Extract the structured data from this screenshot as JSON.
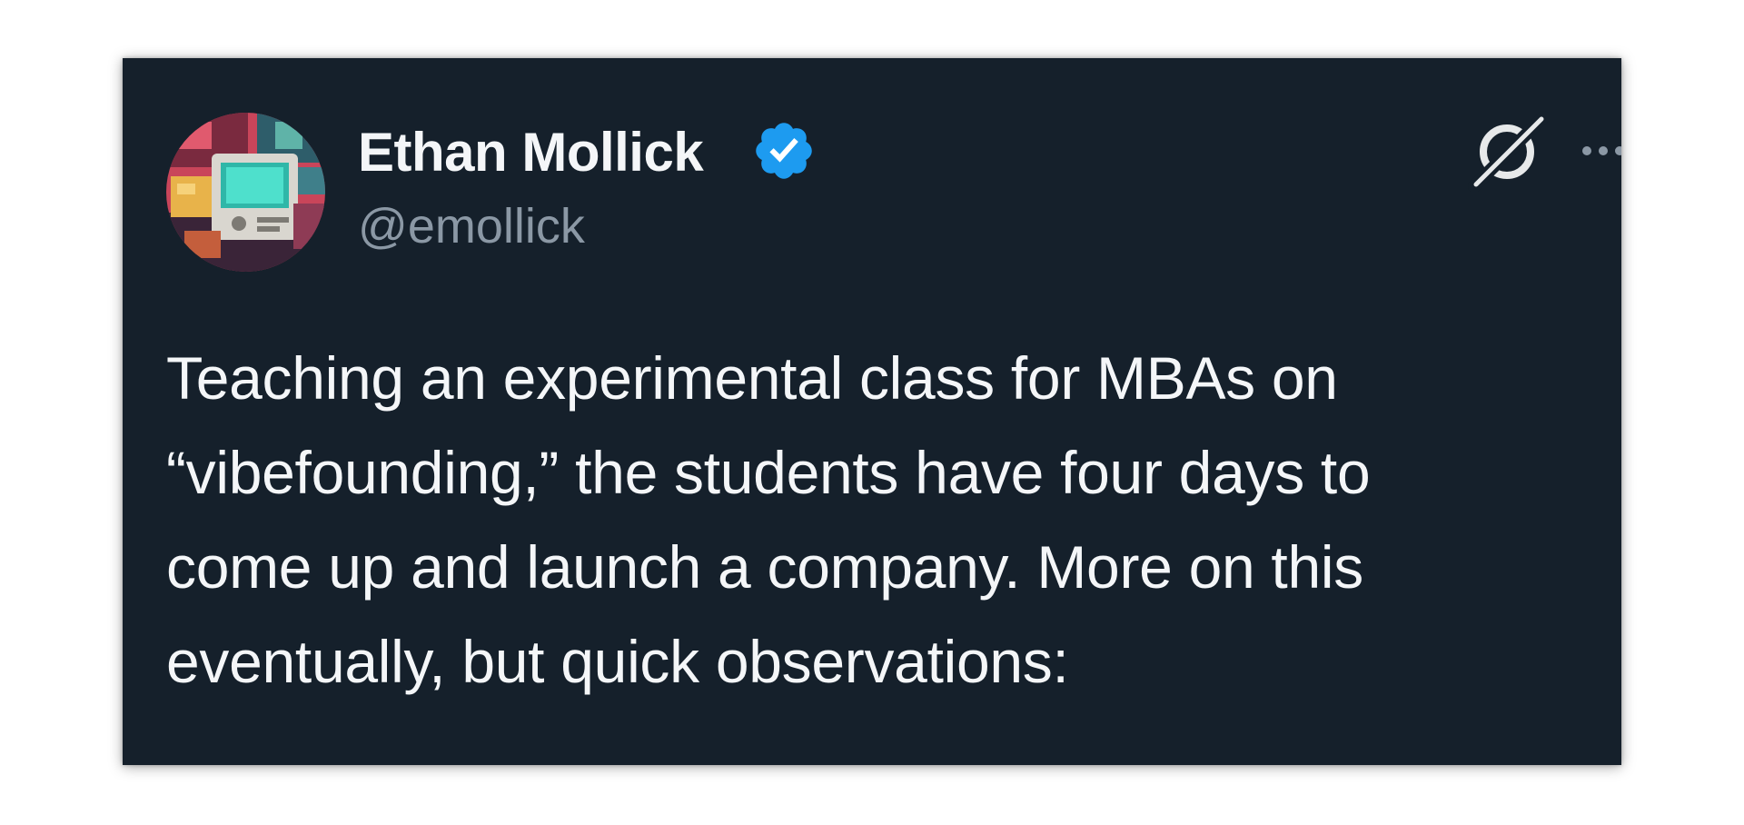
{
  "tweet": {
    "author": {
      "display_name": "Ethan Mollick",
      "handle": "@emollick",
      "verified": true,
      "avatar_icon": "pixel-art-retro-computer-avatar"
    },
    "text_lines": [
      "Teaching an experimental class for MBAs on",
      "“vibefounding,” the students have four days to",
      "come up and launch a company. More on this",
      "eventually, but quick observations:"
    ],
    "icons": {
      "verified": "verified-checkmark-icon",
      "grok": "grok-slash-icon",
      "more": "more-options-icon"
    }
  },
  "colors": {
    "background": "#15202b",
    "text_primary": "#f4f6f8",
    "text_secondary": "#8b98a5",
    "verified_blue": "#1d9bf0"
  }
}
